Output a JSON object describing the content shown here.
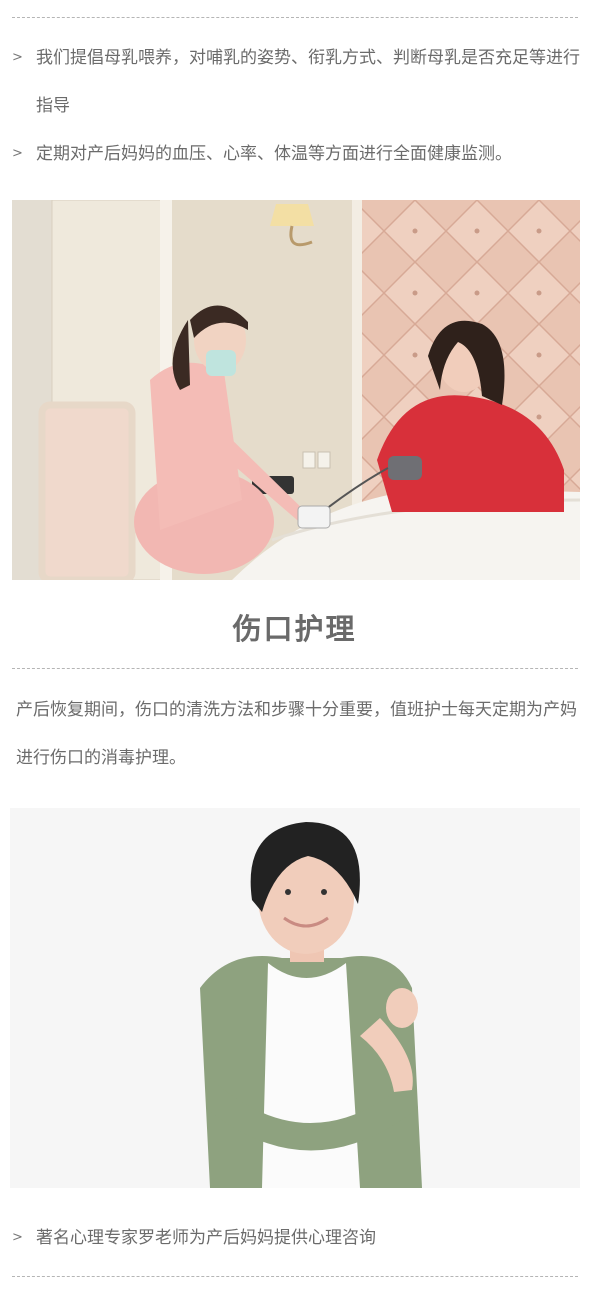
{
  "top_bullets": [
    {
      "arrow": ">",
      "text": "我们提倡母乳喂养，对哺乳的姿势、衔乳方式、判断母乳是否充足等进行指导"
    },
    {
      "arrow": ">",
      "text": "定期对产后妈妈的血压、心率、体温等方面进行全面健康监测。"
    }
  ],
  "section": {
    "title": "伤口护理",
    "paragraph": "产后恢复期间，伤口的清洗方法和步骤十分重要，值班护士每天定期为产妈进行伤口的消毒护理。"
  },
  "bottom_bullet": {
    "arrow": ">",
    "text": "著名心理专家罗老师为产后妈妈提供心理咨询"
  }
}
